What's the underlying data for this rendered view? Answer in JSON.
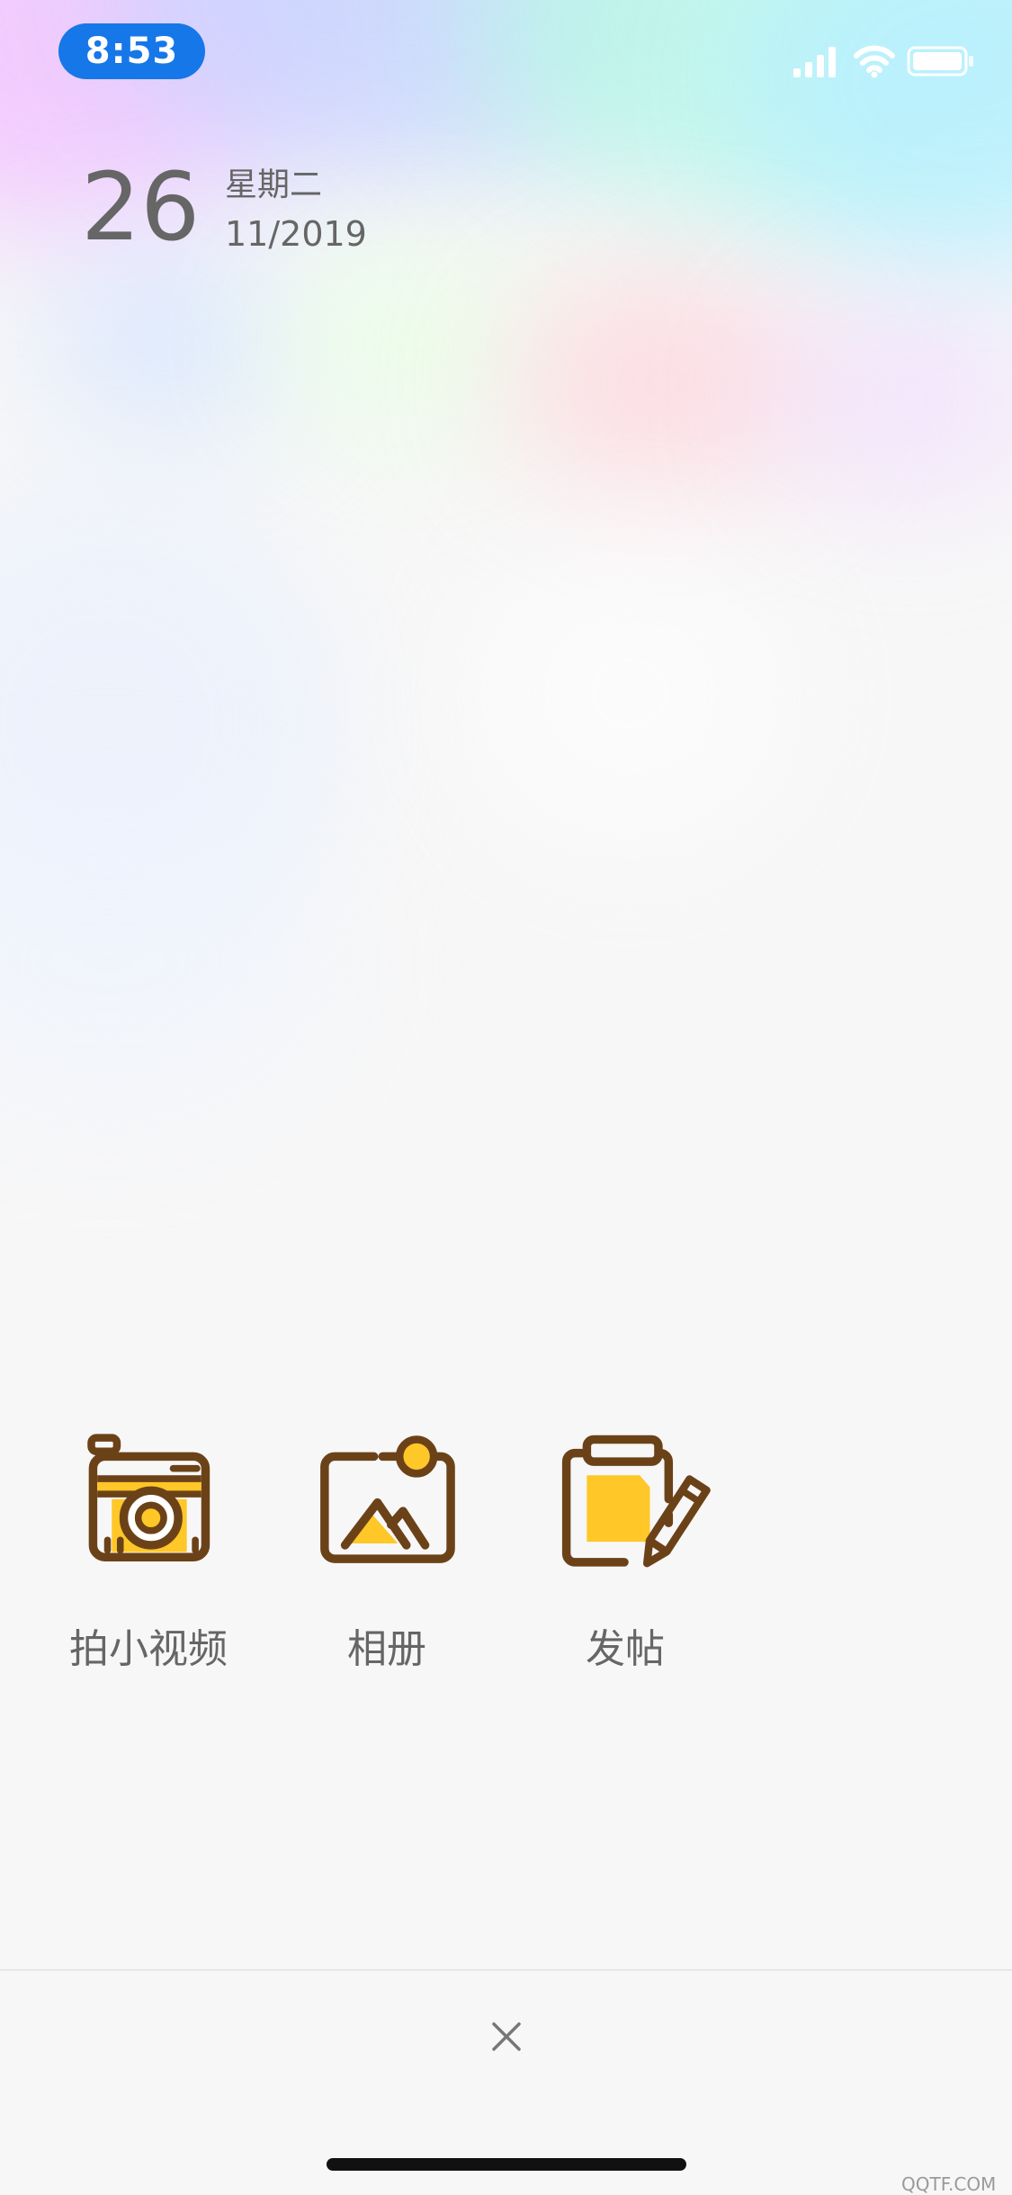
{
  "status_bar": {
    "time": "8:53",
    "icons": [
      "signal-icon",
      "wifi-icon",
      "battery-icon"
    ],
    "time_pill_color": "#1677e8"
  },
  "date": {
    "day": "26",
    "weekday": "星期二",
    "month_year": "11/2019"
  },
  "actions": [
    {
      "label": "拍小视频",
      "icon": "camera-icon"
    },
    {
      "label": "相册",
      "icon": "album-icon"
    },
    {
      "label": "发帖",
      "icon": "clipboard-pen-icon"
    }
  ],
  "close_button": {
    "icon": "close-icon"
  },
  "colors": {
    "icon_outline": "#6b4218",
    "icon_fill": "#ffc727",
    "text": "#666666"
  },
  "watermark": "QQTF.COM"
}
